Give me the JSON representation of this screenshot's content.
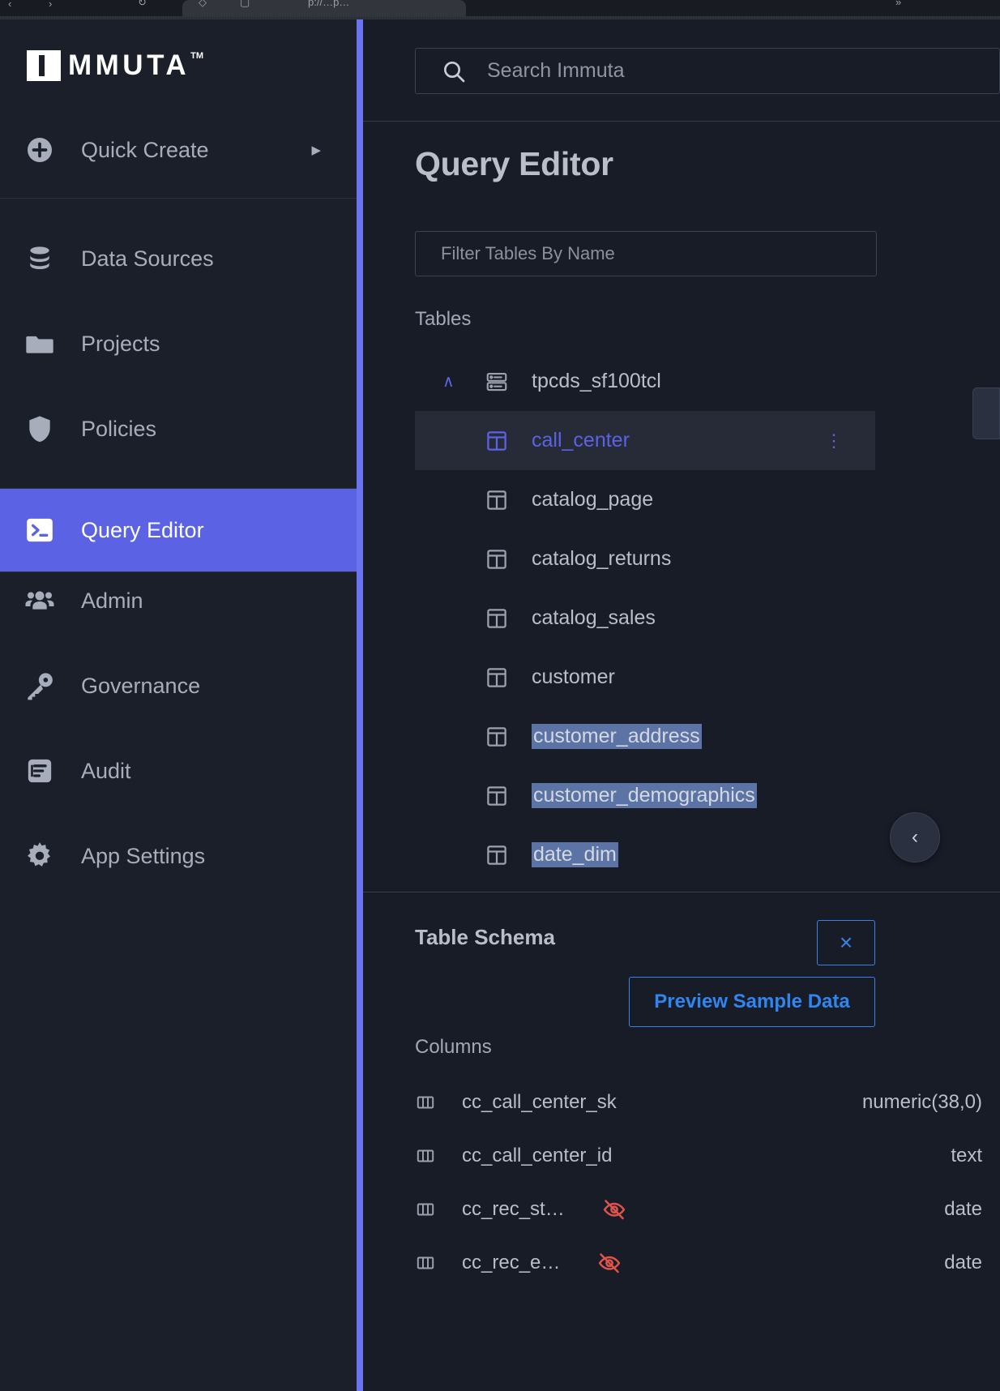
{
  "browser": {
    "glyphs": [
      "↻",
      "⌂",
      "▢",
      "⋮",
      "»"
    ]
  },
  "sidebar": {
    "logo_text": "MMUTA",
    "logo_tm": "TM",
    "quick_create": {
      "label": "Quick Create",
      "icon": "plus-circle-icon",
      "caret": "▶"
    },
    "items": [
      {
        "label": "Data Sources",
        "icon": "database-icon",
        "active": false
      },
      {
        "label": "Projects",
        "icon": "folder-icon",
        "active": false
      },
      {
        "label": "Policies",
        "icon": "shield-icon",
        "active": false
      },
      {
        "label": "Query Editor",
        "icon": "terminal-icon",
        "active": true
      },
      {
        "label": "Admin",
        "icon": "users-icon",
        "active": false
      },
      {
        "label": "Governance",
        "icon": "key-icon",
        "active": false
      },
      {
        "label": "Audit",
        "icon": "document-list-icon",
        "active": false
      },
      {
        "label": "App Settings",
        "icon": "gear-icon",
        "active": false
      }
    ]
  },
  "search": {
    "placeholder": "Search Immuta",
    "value": "",
    "icon": "search-icon"
  },
  "main": {
    "page_title": "Query Editor",
    "filter": {
      "placeholder": "Filter Tables By Name",
      "value": ""
    },
    "tables_label": "Tables",
    "tree": {
      "schema": {
        "name": "tpcds_sf100tcl",
        "expanded": true,
        "chevron": "∧",
        "icon": "server-icon"
      },
      "tables": [
        {
          "name": "call_center",
          "selected": true,
          "text_selected": false,
          "icon": "table-icon",
          "kebab": "⋮"
        },
        {
          "name": "catalog_page",
          "selected": false,
          "text_selected": false,
          "icon": "table-icon"
        },
        {
          "name": "catalog_returns",
          "selected": false,
          "text_selected": false,
          "icon": "table-icon"
        },
        {
          "name": "catalog_sales",
          "selected": false,
          "text_selected": false,
          "icon": "table-icon"
        },
        {
          "name": "customer",
          "selected": false,
          "text_selected": false,
          "icon": "table-icon"
        },
        {
          "name": "customer_address",
          "selected": false,
          "text_selected": true,
          "icon": "table-icon"
        },
        {
          "name": "customer_demographics",
          "selected": false,
          "text_selected": true,
          "icon": "table-icon"
        },
        {
          "name": "date_dim",
          "selected": false,
          "text_selected": true,
          "icon": "table-icon"
        }
      ]
    },
    "collapse_pill": {
      "icon": "chevron-left-icon",
      "glyph": "‹"
    }
  },
  "schema_panel": {
    "title": "Table Schema",
    "close_label": "×",
    "preview_label": "Preview Sample Data",
    "columns_label": "Columns",
    "columns": [
      {
        "name": "cc_call_center_sk",
        "type": "numeric(38,0)",
        "masked": false
      },
      {
        "name": "cc_call_center_id",
        "type": "text",
        "masked": false
      },
      {
        "name": "cc_rec_st…",
        "type": "date",
        "masked": true
      },
      {
        "name": "cc_rec_e…",
        "type": "date",
        "masked": true
      }
    ]
  },
  "colors": {
    "accent_indigo": "#5b62e3",
    "accent_blue": "#3b82e6",
    "selection_blue": "#5c74a5",
    "masked_red": "#e0534b",
    "sidebar_bg": "#1b1f2a",
    "main_bg": "#181c27"
  }
}
